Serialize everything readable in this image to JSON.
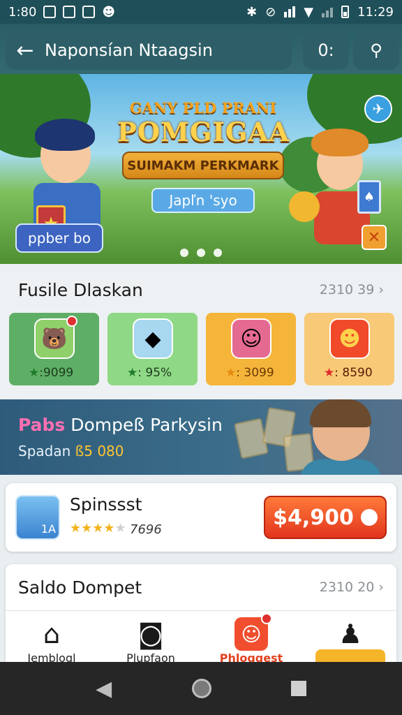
{
  "status_bar": {
    "time_left": "1:80",
    "time_right": "11:29"
  },
  "app_bar": {
    "title": "Naponsían Ntaagsin",
    "action_label": "0:"
  },
  "hero": {
    "line1": "GANY PLD PRANI",
    "line2": "POMGIGAA",
    "line3": "SUIMAKM PERKMARK",
    "cta": "Japľn 'syo",
    "tag": "ppber bo",
    "page_count": 3
  },
  "featured": {
    "title": "Fusile Dlaskan",
    "link": "2310 39 ›",
    "tiles": [
      {
        "rating": ":9099",
        "bg": "#5fae66",
        "icon": "bear-game-icon"
      },
      {
        "rating": ": 95%",
        "bg": "#8fd886",
        "icon": "puzzle-game-icon"
      },
      {
        "rating": ": 3099",
        "bg": "#f5b53a",
        "icon": "girl-game-icon"
      },
      {
        "rating": ": 8590",
        "bg": "#f8c976",
        "icon": "smiley-game-icon"
      }
    ]
  },
  "promo": {
    "title_pink": "Pabs",
    "title_rest": " Dompeß Parkysin",
    "subtitle": "Spadan ",
    "subtitle_amount": "ß5 080"
  },
  "app_card": {
    "name": "Spinssst",
    "rating": 3.5,
    "rating_count": "7696",
    "price": "$4,900",
    "icon_badge": "1A"
  },
  "saldo": {
    "title": "Saldo Dompet",
    "link": "2310 20 ›",
    "nav": [
      {
        "label": "Jemblogl",
        "icon": "home-icon"
      },
      {
        "label": "Plupfaon",
        "icon": "tray-icon"
      },
      {
        "label": "Phloggest",
        "icon": "smile-icon"
      },
      {
        "label": "",
        "icon": "profile-icon"
      }
    ]
  },
  "colors": {
    "accent": "#e2351d",
    "header": "#2e5f68",
    "brand_yellow": "#ffd24c"
  }
}
